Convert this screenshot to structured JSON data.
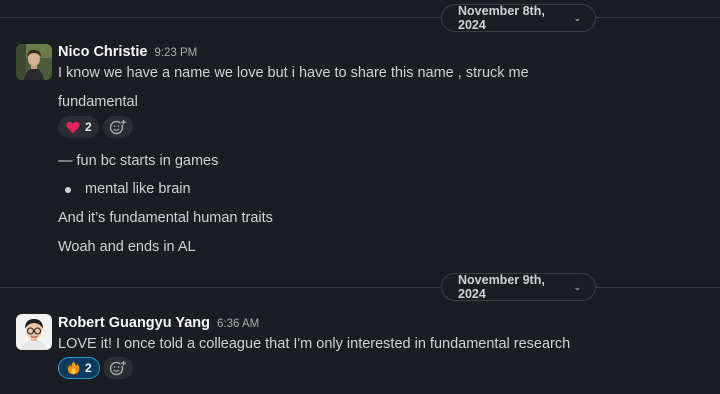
{
  "day1": {
    "date_label": "November 8th, 2024",
    "message": {
      "author": "Nico Christie",
      "time": "9:23 PM",
      "lines": [
        "I know we have a name we love but i have to share this name , struck me",
        "fundamental",
        "— fun bc starts in games",
        "mental like brain",
        "And it’s fundamental human traits",
        "Woah and ends in AL"
      ],
      "reaction": {
        "emoji": "heart-emoji",
        "count": "2"
      }
    }
  },
  "day2": {
    "date_label": "November 9th, 2024",
    "message": {
      "author": "Robert Guangyu Yang",
      "time": "6:36 AM",
      "lines": [
        "LOVE it! I once told a colleague that I'm only interested in fundamental research"
      ],
      "reaction": {
        "emoji": "fire-emoji",
        "count": "2"
      }
    }
  },
  "colors": {
    "background": "#1a1d21",
    "text": "#d1d2d3",
    "selected_reaction_bg": "#0d3a5c",
    "selected_reaction_border": "#1d9bd1"
  },
  "icons": {
    "date_chevron": "chevron-down-icon",
    "add_reaction": "add-reaction-icon"
  }
}
